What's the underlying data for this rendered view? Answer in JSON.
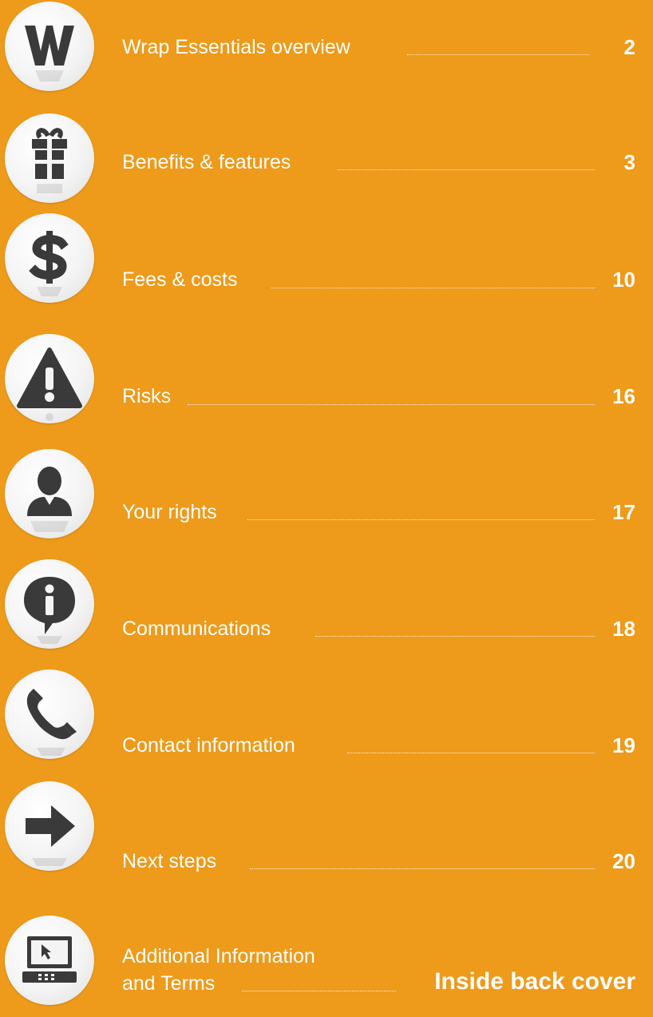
{
  "toc": {
    "items": [
      {
        "label": "Wrap Essentials overview",
        "page": "2",
        "icon": "w-letter-icon"
      },
      {
        "label": "Benefits & features",
        "page": "3",
        "icon": "gift-icon"
      },
      {
        "label": "Fees & costs",
        "page": "10",
        "icon": "dollar-icon"
      },
      {
        "label": "Risks",
        "page": "16",
        "icon": "warning-icon"
      },
      {
        "label": "Your rights",
        "page": "17",
        "icon": "person-icon"
      },
      {
        "label": "Communications",
        "page": "18",
        "icon": "info-icon"
      },
      {
        "label": "Contact information",
        "page": "19",
        "icon": "phone-icon"
      },
      {
        "label": "Next steps",
        "page": "20",
        "icon": "arrow-right-icon"
      },
      {
        "label_line1": "Additional Information",
        "label_line2": "and Terms",
        "page": "Inside back cover",
        "icon": "laptop-icon"
      }
    ]
  },
  "colors": {
    "background": "#ee9a1a",
    "text": "#ffffff",
    "icon_fill": "#3a3a3a",
    "icon_circle": "#f4f4f4"
  }
}
